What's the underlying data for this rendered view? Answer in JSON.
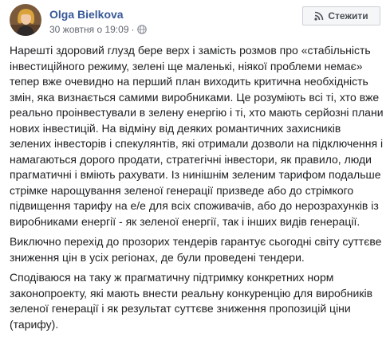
{
  "post": {
    "author_name": "Olga Bielkova",
    "timestamp": "30 жовтня о 19:09",
    "separator": "·",
    "privacy_icon": "globe-icon",
    "follow_icon": "rss-icon",
    "follow_label": "Стежити",
    "paragraphs": [
      "Нарешті здоровий глузд бере верх і замість розмов про «стабільність інвестиційного режиму, зелені ще маленькі, ніякої проблеми немає» тепер вже очевидно на перший план виходить критична необхідність змін, яка визнається самими виробниками. Це розуміють всі ті, хто вже реально проінвестували в зелену енергію і ті, хто мають серйозні плани нових інвестицій. На відміну від деяких романтичних захисників зелених інвесторів і спекулянтів, які отримали дозволи на підключення і намагаються дорого продати, стратегічні інвестори, як правило, люди прагматичні і вміють рахувати. Із нинішнім зеленим тарифом подальше стрімке нарощування зеленої генерації призведе або до стрімкого підвищення тарифу на е/е для всіх споживачів, або до нерозрахунків із виробниками енергії - як зеленої енергії, так і інших видів генерації.",
      "Виключно перехід до прозорих тендерів гарантує сьогодні світу суттєве зниження цін в усіх регіонах, де були проведені тендери.",
      "Сподіваюся на таку ж прагматичну підтримку конкретних норм законопроекту, які мають внести реальну конкуренцію для виробників зеленої генерації і як результат суттєве зниження пропозицій ціни (тарифу)."
    ]
  }
}
